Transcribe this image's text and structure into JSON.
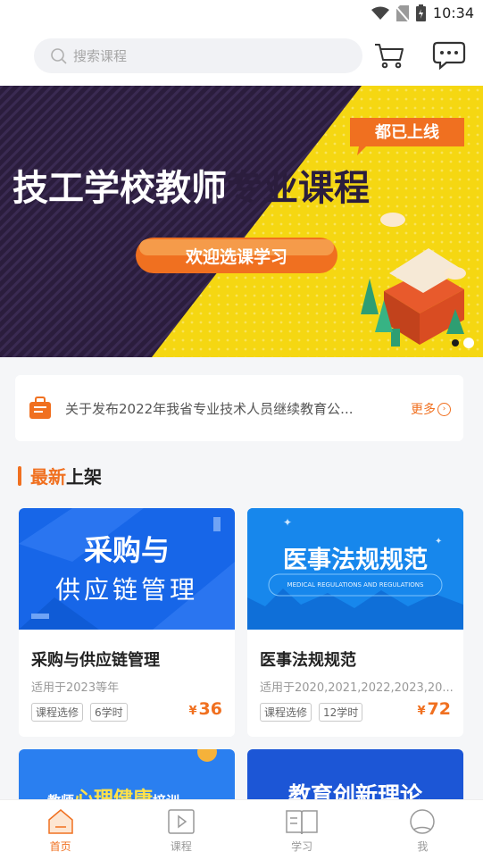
{
  "status": {
    "time": "10:34"
  },
  "search": {
    "placeholder": "搜索课程"
  },
  "banner": {
    "headline_1": "技工学校教师",
    "headline_2": "专业课程",
    "badge": "都已上线",
    "button": "欢迎选课学习"
  },
  "notice": {
    "text": "关于发布2022年我省专业技术人员继续教育公...",
    "more": "更多"
  },
  "section": {
    "title_highlight": "最新",
    "title_rest": "上架"
  },
  "courses": [
    {
      "thumb_line1": "采购与",
      "thumb_line2": "供应链管理",
      "title": "采购与供应链管理",
      "applies": "适用于2023等年",
      "tags": [
        "课程选修",
        "6学时"
      ],
      "currency": "¥",
      "price": "36"
    },
    {
      "thumb_line1": "医事法规规范",
      "thumb_line2": "MEDICAL REGULATIONS AND REGULATIONS",
      "title": "医事法规规范",
      "applies": "适用于2020,2021,2022,2023,20...",
      "tags": [
        "课程选修",
        "12学时"
      ],
      "currency": "¥",
      "price": "72"
    },
    {
      "thumb_a": "教师",
      "thumb_b": "心理健康",
      "thumb_c": "培训"
    },
    {
      "thumb_line1": "教育创新理论"
    }
  ],
  "tabs": [
    {
      "label": "首页",
      "icon": "home-icon",
      "active": true
    },
    {
      "label": "课程",
      "icon": "play-icon",
      "active": false
    },
    {
      "label": "学习",
      "icon": "book-icon",
      "active": false
    },
    {
      "label": "我",
      "icon": "user-icon",
      "active": false
    }
  ],
  "colors": {
    "accent": "#f07020",
    "banner_yellow": "#f5d712",
    "card_blue": "#1766e8"
  }
}
